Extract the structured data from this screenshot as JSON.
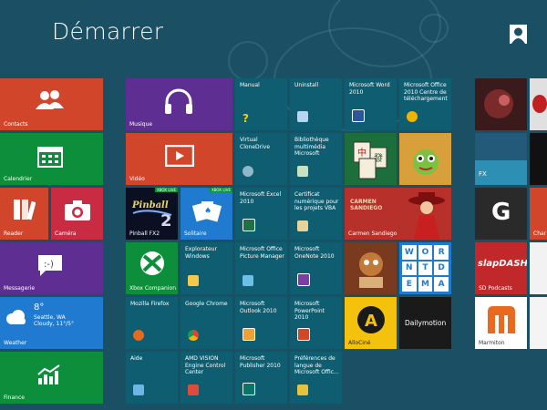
{
  "title": "Démarrer",
  "colors": {
    "background": "#1b4f63",
    "orange": "#d1462b",
    "purple": "#5f2e93",
    "green": "#0d8e3a",
    "blue": "#1f7ad0",
    "red": "#c92b43",
    "small_tile": "#0f5d71"
  },
  "tiles": {
    "contacts": "Contacts",
    "calendrier": "Calendrier",
    "reader": "Reader",
    "camera": "Caméra",
    "messagerie": "Messagerie",
    "weather": "Weather",
    "weather_temp": "8°",
    "weather_city": "Seattle, WA",
    "weather_cond": "Cloudy, 11°/5°",
    "finance": "Finance",
    "musique": "Musique",
    "video": "Vidéo",
    "pinball": "Pinball FX2",
    "pinball_badge": "XBOX LIVE",
    "solitaire": "Solitaire",
    "solitaire_badge": "XBOX LIVE",
    "xbox": "Xbox Companion",
    "manual": "Manual",
    "uninstall": "Uninstall",
    "word": "Microsoft Word 2010",
    "office_center": "Microsoft Office 2010 Centre de téléchargement",
    "virtual_clone": "Virtual CloneDrive",
    "bibliotheque": "Bibliothèque multimédia Microsoft",
    "excel": "Microsoft Excel 2010",
    "certificat": "Certificat numérique pour les projets VBA",
    "carmen": "Carmen Sandiego",
    "carmen_logo": "CARMEN SANDIEGO",
    "explorateur": "Explorateur Windows",
    "picture_manager": "Microsoft Office Picture Manager",
    "onenote": "Microsoft OneNote 2010",
    "wordament": [
      "W",
      "O",
      "R",
      "N",
      "T",
      "D",
      "E",
      "M",
      "A"
    ],
    "firefox": "Mozilla Firefox",
    "chrome": "Google Chrome",
    "outlook": "Microsoft Outlook 2010",
    "powerpoint": "Microsoft PowerPoint 2010",
    "allocine": "AlloCiné",
    "dailymotion": "Dailymotion",
    "aide": "Aide",
    "amd": "AMD VISION Engine Control Center",
    "publisher": "Microsoft Publisher 2010",
    "langue": "Préférences de langue de Microsoft Offic...",
    "sd_podcasts": "SD Podcasts",
    "slapdash": "slapDASH",
    "marmiton": "Marmiton",
    "fx": "FX",
    "char_partial": "Char"
  }
}
